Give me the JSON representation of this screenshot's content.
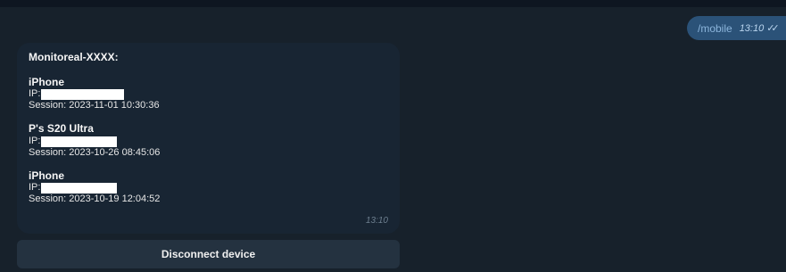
{
  "outgoing": {
    "text": "/mobile",
    "time": "13:10",
    "read_mark": "✓✓",
    "read_icon": "double-check-icon"
  },
  "incoming": {
    "sender": "Monitoreal-XXXX:",
    "devices": [
      {
        "name": "iPhone",
        "ip_label": "IP:",
        "session": "Session: 2023-11-01 10:30:36"
      },
      {
        "name": "P's S20 Ultra",
        "ip_label": "IP:",
        "session": "Session: 2023-10-26 08:45:06"
      },
      {
        "name": "iPhone",
        "ip_label": "IP:",
        "session": "Session: 2023-10-19 12:04:52"
      }
    ],
    "time": "13:10"
  },
  "keyboard": {
    "button_label": "Disconnect device"
  },
  "colors": {
    "background": "#17212b",
    "outgoing_bubble": "#2b5278",
    "incoming_bubble": "#182533",
    "button": "#243240"
  }
}
